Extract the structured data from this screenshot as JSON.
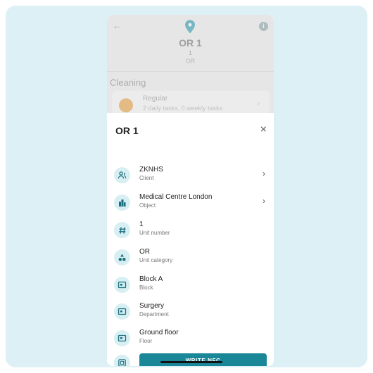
{
  "header": {
    "title": "OR 1",
    "unit_number": "1",
    "category": "OR"
  },
  "cleaning": {
    "section_title": "Cleaning",
    "task_name": "Regular",
    "task_desc": "2 daily tasks, 0 weekly tasks"
  },
  "sheet": {
    "title": "OR 1",
    "rows": [
      {
        "label": "ZKNHS",
        "sub": "Client",
        "icon": "people-icon",
        "chevron": true
      },
      {
        "label": "Medical Centre London",
        "sub": "Object",
        "icon": "building-icon",
        "chevron": true
      },
      {
        "label": "1",
        "sub": "Unit number",
        "icon": "hash-icon",
        "chevron": false
      },
      {
        "label": "OR",
        "sub": "Unit category",
        "icon": "shapes-icon",
        "chevron": false
      },
      {
        "label": "Block A",
        "sub": "Block",
        "icon": "block-icon",
        "chevron": false
      },
      {
        "label": "Surgery",
        "sub": "Department",
        "icon": "block-icon",
        "chevron": false
      },
      {
        "label": "Ground floor",
        "sub": "Floor",
        "icon": "block-icon",
        "chevron": false
      }
    ],
    "nfc_button": "WRITE NFC"
  },
  "colors": {
    "accent": "#1a8799",
    "icon_bg": "#d7eef3",
    "frame_bg": "#dcf0f5"
  }
}
